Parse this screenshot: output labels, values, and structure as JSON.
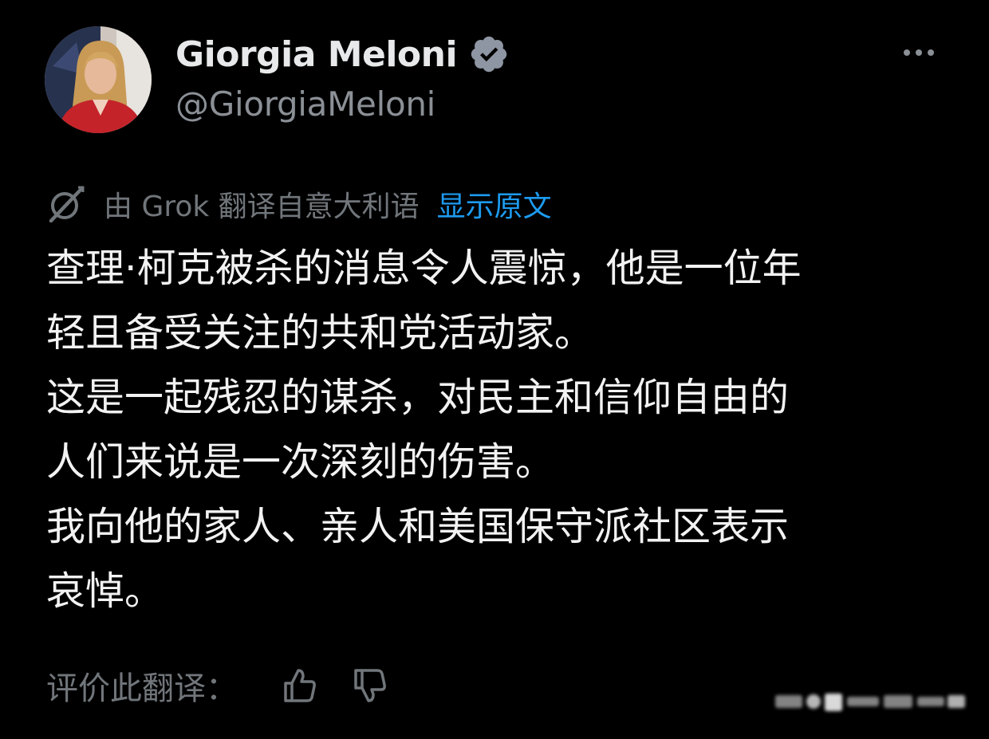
{
  "author": {
    "display_name": "Giorgia Meloni",
    "handle": "@GiorgiaMeloni",
    "verified": true
  },
  "translation": {
    "notice": "由 Grok 翻译自意大利语",
    "show_original_label": "显示原文"
  },
  "tweet": {
    "lines": [
      " 查理·柯克被杀的消息令人震惊，他是一位年",
      "轻且备受关注的共和党活动家。",
      "这是一起残忍的谋杀，对民主和信仰自由的",
      "人们来说是一次深刻的伤害。",
      "我向他的家人、亲人和美国保守派社区表示",
      "哀悼。"
    ]
  },
  "rating": {
    "label": "评价此翻译："
  },
  "icons": {
    "verified": "verified-badge-icon",
    "more": "more-icon",
    "grok": "grok-icon",
    "thumbs_up": "thumbs-up-icon",
    "thumbs_down": "thumbs-down-icon"
  },
  "colors": {
    "background": "#000000",
    "text": "#e7e9ea",
    "muted": "#71767b",
    "link": "#1d9bf0"
  }
}
